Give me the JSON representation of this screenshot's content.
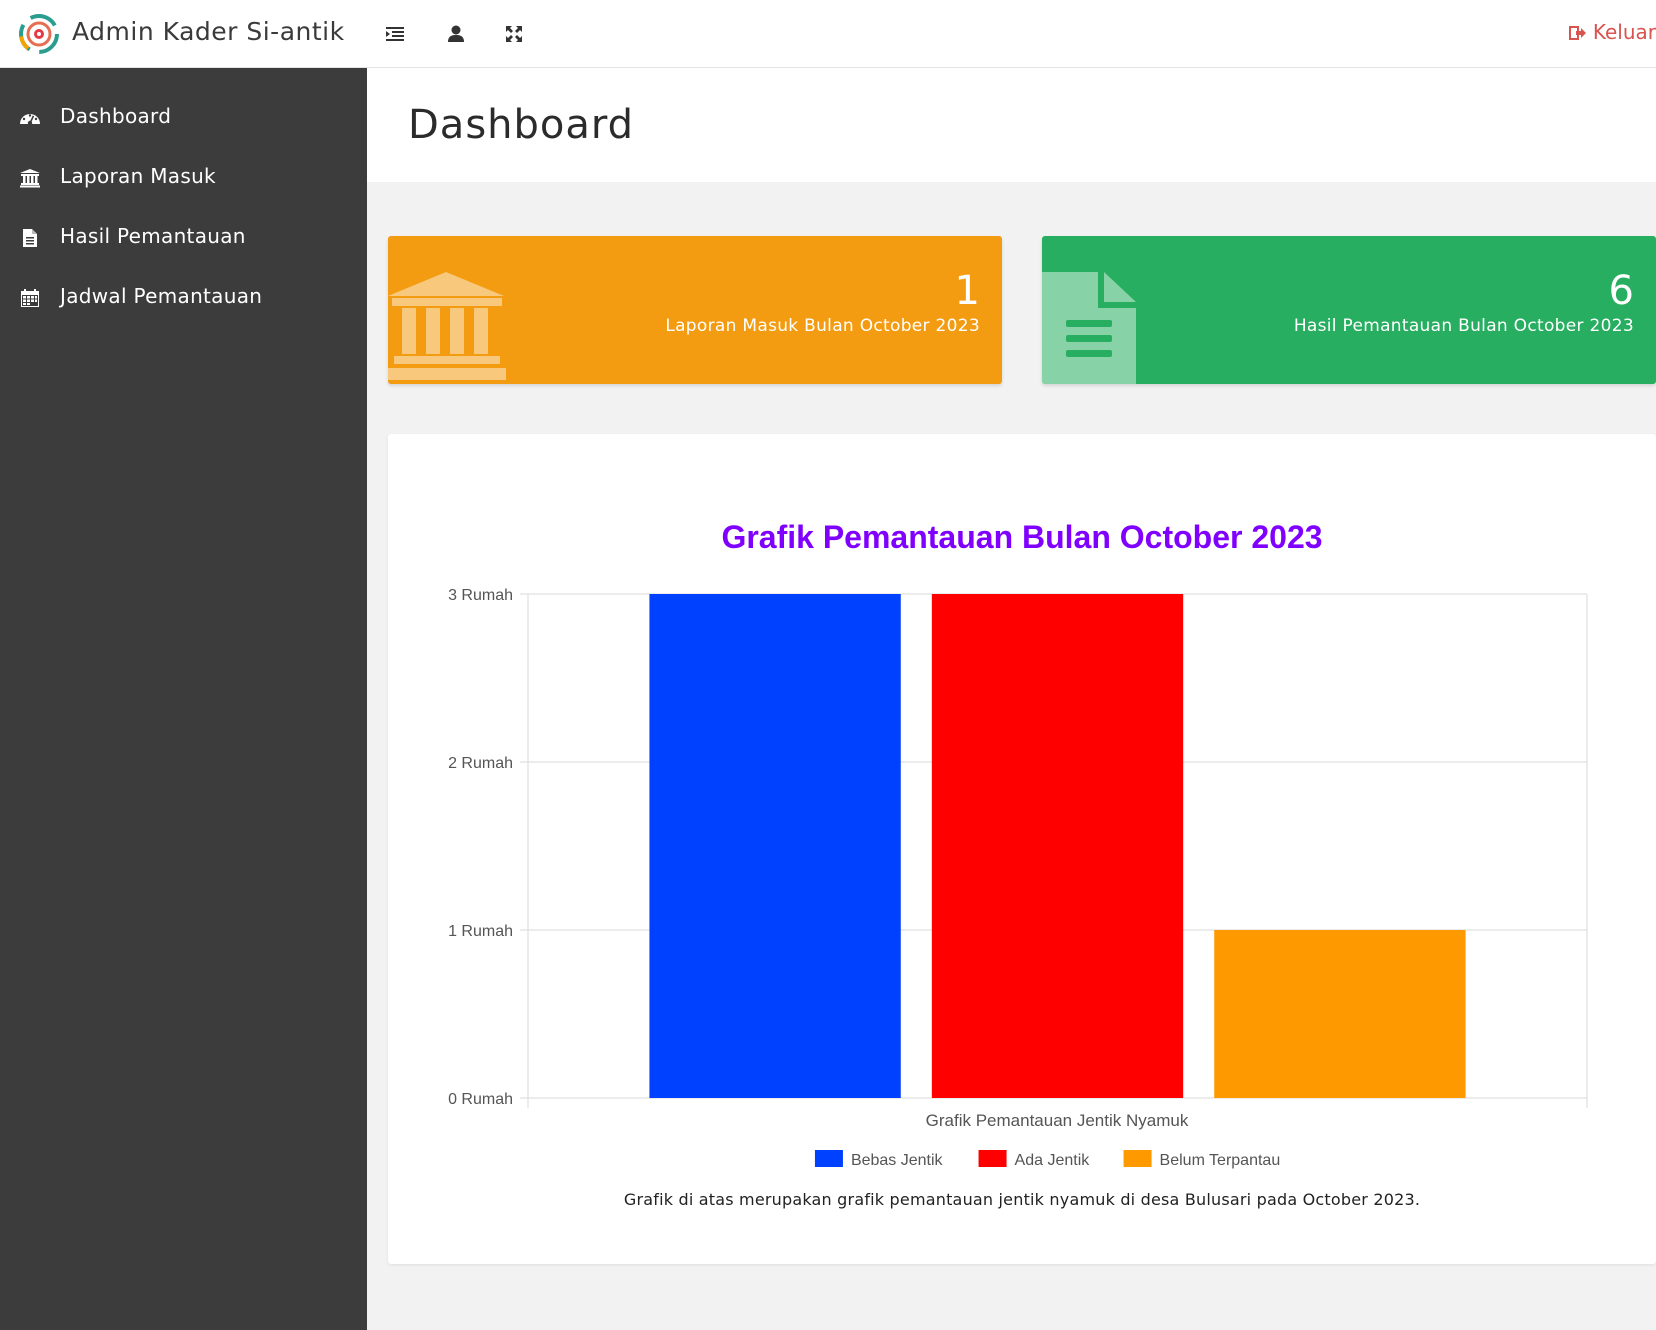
{
  "app": {
    "title": "Admin Kader Si-antik"
  },
  "topbar": {
    "logout_label": "Keluar"
  },
  "sidebar": {
    "items": [
      {
        "label": "Dashboard",
        "icon": "dashboard-icon"
      },
      {
        "label": "Laporan Masuk",
        "icon": "institution-icon"
      },
      {
        "label": "Hasil Pemantauan",
        "icon": "file-icon"
      },
      {
        "label": "Jadwal Pemantauan",
        "icon": "calendar-icon"
      }
    ]
  },
  "page": {
    "title": "Dashboard"
  },
  "stats": [
    {
      "value": "1",
      "caption": "Laporan Masuk Bulan October 2023",
      "color": "#f39c12",
      "icon": "institution-icon"
    },
    {
      "value": "6",
      "caption": "Hasil Pemantauan Bulan October 2023",
      "color": "#27ae60",
      "icon": "file-text-icon"
    }
  ],
  "chart_data": {
    "type": "bar",
    "title": "Grafik Pemantauan Bulan October 2023",
    "xlabel": "Grafik Pemantauan Jentik Nyamuk",
    "ylabel": "",
    "ylim": [
      0,
      3
    ],
    "y_ticks": [
      "0 Rumah",
      "1 Rumah",
      "2 Rumah",
      "3 Rumah"
    ],
    "series": [
      {
        "name": "Bebas Jentik",
        "values": [
          3
        ],
        "color": "#0040ff"
      },
      {
        "name": "Ada Jentik",
        "values": [
          3
        ],
        "color": "#ff0000"
      },
      {
        "name": "Belum Terpantau",
        "values": [
          1
        ],
        "color": "#ff9900"
      }
    ],
    "title_color": "#8000ff",
    "grid": true,
    "legend_position": "bottom"
  },
  "chart_caption": "Grafik di atas merupakan grafik pemantauan jentik nyamuk di desa Bulusari pada October 2023."
}
